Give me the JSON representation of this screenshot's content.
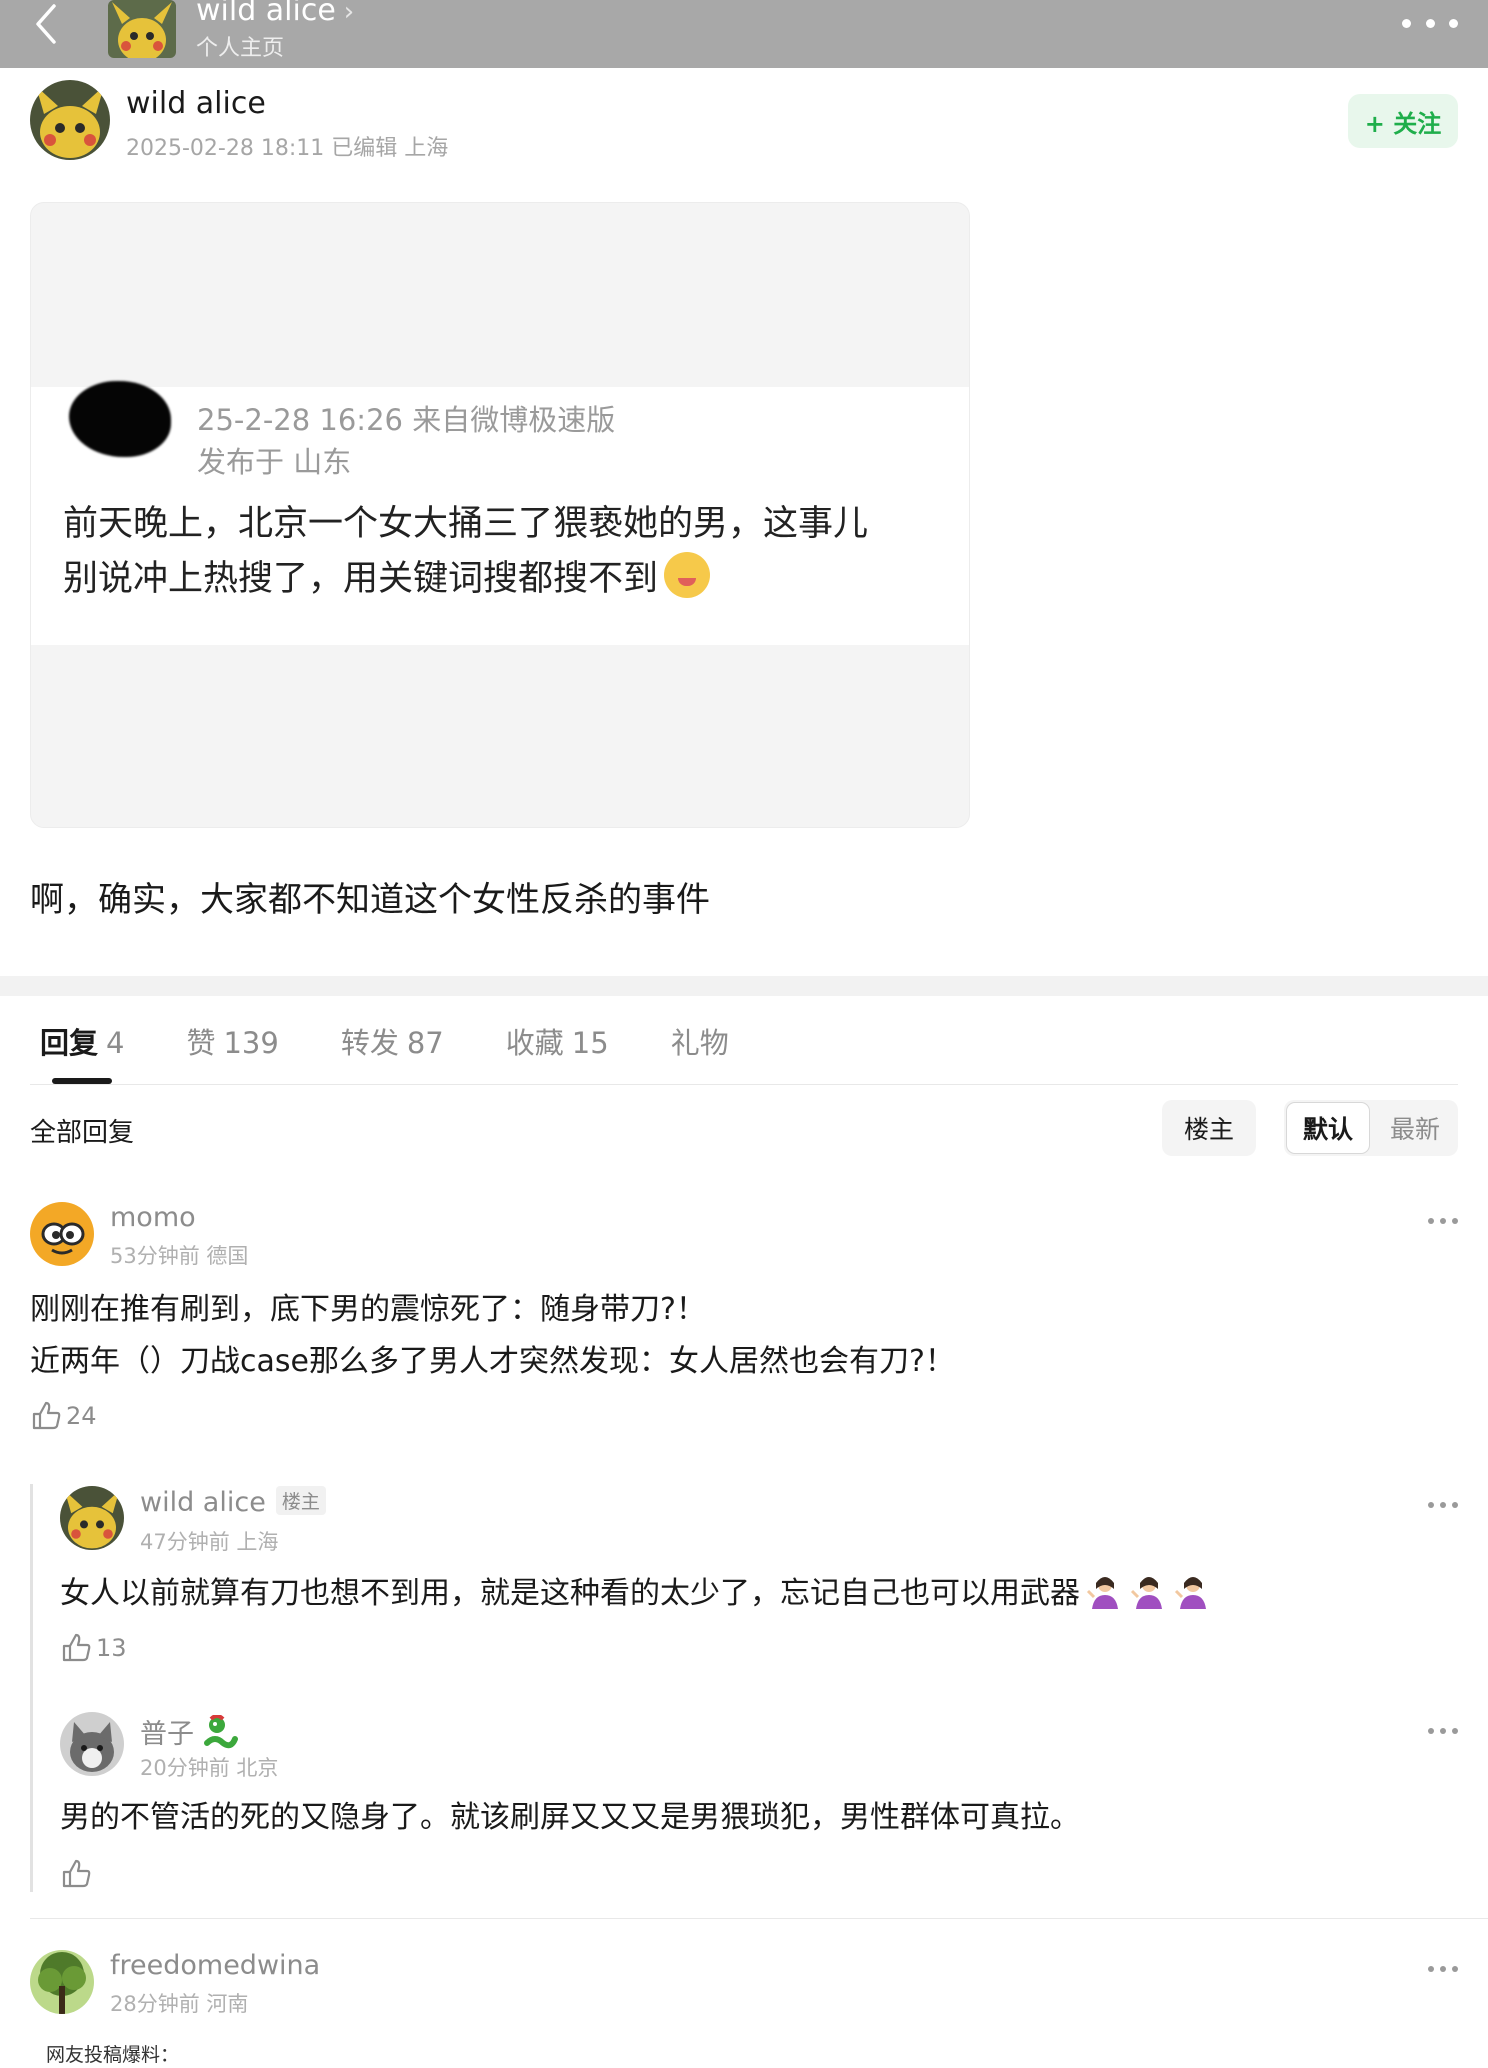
{
  "topbar": {
    "name": "wild alice",
    "chevron": "›",
    "subtitle": "个人主页"
  },
  "post": {
    "author": "wild alice",
    "meta": "2025-02-28 18:11 已编辑 上海",
    "follow_label": "+ 关注",
    "text": "啊，确实，大家都不知道这个女性反杀的事件"
  },
  "card": {
    "time_source": "25-2-28 16:26  来自微博极速版",
    "location": "发布于 山东",
    "line1": "前天晚上，北京一个女大捅三了猥亵她的男，这事儿",
    "line2": "别说冲上热搜了，用关键词搜都搜不到"
  },
  "tabs": [
    {
      "label": "回复",
      "count": "4"
    },
    {
      "label": "赞",
      "count": "139"
    },
    {
      "label": "转发",
      "count": "87"
    },
    {
      "label": "收藏",
      "count": "15"
    },
    {
      "label": "礼物",
      "count": ""
    }
  ],
  "replies_header": {
    "title": "全部回复",
    "op_filter": "楼主",
    "sort_default": "默认",
    "sort_latest": "最新"
  },
  "comments": [
    {
      "name": "momo",
      "meta": "53分钟前 德国",
      "line1": "刚刚在推有刷到，底下男的震惊死了：随身带刀?！",
      "line2": "近两年（）刀战case那么多了男人才突然发现：女人居然也会有刀?！",
      "likes": "24"
    },
    {
      "name": "wild alice",
      "badge": "楼主",
      "meta": "47分钟前 上海",
      "text": "女人以前就算有刀也想不到用，就是这种看的太少了，忘记自己也可以用武器",
      "likes": "13"
    },
    {
      "name": "普子",
      "meta": "20分钟前 北京",
      "text": "男的不管活的死的又隐身了。就该刷屏又又又是男猥琐犯，男性群体可真拉。",
      "likes": ""
    },
    {
      "name": "freedomedwina",
      "meta": "28分钟前 河南",
      "snippet": "网友投稿爆料："
    }
  ],
  "icons": {
    "back": "back-chevron-icon",
    "more": "more-dots-icon",
    "like": "thumbs-up-icon"
  },
  "colors": {
    "topbar_bg": "#a8a8a8",
    "follow_bg": "#e8f7ec",
    "follow_text": "#1fae4b"
  }
}
